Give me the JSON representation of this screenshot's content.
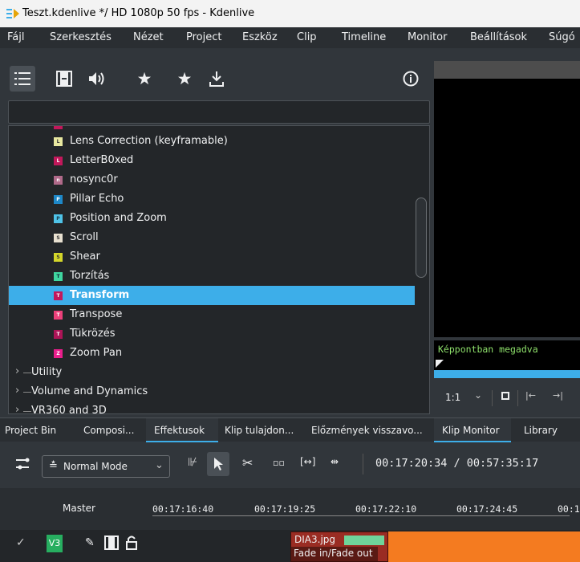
{
  "window": {
    "title": "Teszt.kdenlive */ HD 1080p 50 fps - Kdenlive"
  },
  "menu": [
    "Fájl",
    "Szerkesztés",
    "Nézet",
    "Project",
    "Eszköz",
    "Clip",
    "Timeline",
    "Monitor",
    "Beállítások",
    "Súgó"
  ],
  "effects_toolbar": {
    "icons": [
      "list-icon",
      "film-icon",
      "audio-icon",
      "custom-effects-icon",
      "favorite-star-icon",
      "download-icon",
      "info-icon"
    ]
  },
  "search": {
    "value": ""
  },
  "effects": [
    {
      "label": "Lens Correction  (keyframable)",
      "letter": "L",
      "color": "#e8e8a0"
    },
    {
      "label": "LetterB0xed",
      "letter": "L",
      "color": "#c2185b"
    },
    {
      "label": "nosync0r",
      "letter": "n",
      "color": "#b06a8a"
    },
    {
      "label": "Pillar Echo",
      "letter": "P",
      "color": "#1e88c8"
    },
    {
      "label": "Position and Zoom",
      "letter": "P",
      "color": "#4fc3e8"
    },
    {
      "label": "Scroll",
      "letter": "S",
      "color": "#e8e0d0"
    },
    {
      "label": "Shear",
      "letter": "S",
      "color": "#d4d62a"
    },
    {
      "label": "Torzítás",
      "letter": "T",
      "color": "#3fd6a0"
    },
    {
      "label": "Transform",
      "letter": "T",
      "color": "#c2185b",
      "selected": true
    },
    {
      "label": "Transpose",
      "letter": "T",
      "color": "#ec407a"
    },
    {
      "label": "Tükrözés",
      "letter": "T",
      "color": "#ad1457"
    },
    {
      "label": "Zoom Pan",
      "letter": "Z",
      "color": "#e91e8c"
    }
  ],
  "categories": [
    "Utility",
    "Volume and Dynamics",
    "VR360 and 3D"
  ],
  "monitor": {
    "osd_text": "Képpontban megadva",
    "zoom": "1:1"
  },
  "tabs": [
    {
      "label": "Project Bin"
    },
    {
      "label": "Composi..."
    },
    {
      "label": "Effektusok",
      "active": true
    },
    {
      "label": "Klip tulajdon..."
    },
    {
      "label": "Előzmények visszavo..."
    },
    {
      "label": "Klip Monitor",
      "active": true
    },
    {
      "label": "Library"
    }
  ],
  "timeline_toolbar": {
    "mode": "Normal Mode",
    "timecode": "00:17:20:34 / 00:57:35:17"
  },
  "timeline_header": {
    "master_label": "Master",
    "ticks": [
      "00:17:16:40",
      "00:17:19:25",
      "00:17:22:10",
      "00:17:24:45",
      "00:1"
    ]
  },
  "track": {
    "name": "V3"
  },
  "clip": {
    "name": "DIA3.jpg",
    "transition": "Fade in/Fade out"
  },
  "colors": {
    "accent": "#3daee9",
    "panel": "#31363b",
    "tree_bg": "#232629",
    "clip": "#9a2c23",
    "orange": "#f47b20",
    "track_badge": "#27ae60",
    "osd_text": "#8ee06b"
  }
}
